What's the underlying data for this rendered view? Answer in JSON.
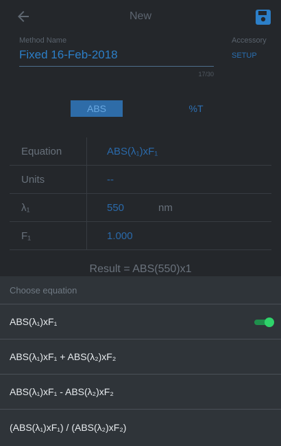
{
  "header": {
    "title": "New"
  },
  "method": {
    "label": "Method Name",
    "value": "Fixed 16-Feb-2018",
    "counter": "17/30"
  },
  "accessory": {
    "label": "Accessory",
    "setup": "SETUP"
  },
  "mode": {
    "abs": "ABS",
    "percent_t": "%T",
    "selected": "ABS"
  },
  "params": {
    "equation": {
      "label": "Equation",
      "value": "ABS(λ₁)xF₁"
    },
    "units": {
      "label": "Units",
      "value": "--"
    },
    "lambda1": {
      "label": "λ₁",
      "value": "550",
      "unit": "nm"
    },
    "f1": {
      "label": "F₁",
      "value": "1.000"
    }
  },
  "result": "Result = ABS(550)x1",
  "sheet": {
    "title": "Choose equation",
    "options": [
      {
        "label": "ABS(λ₁)xF₁",
        "selected": true
      },
      {
        "label": "ABS(λ₁)xF₁ + ABS(λ₂)xF₂",
        "selected": false
      },
      {
        "label": "ABS(λ₁)xF₁ - ABS(λ₂)xF₂",
        "selected": false
      },
      {
        "label": "(ABS(λ₁)xF₁) / (ABS(λ₂)xF₂)",
        "selected": false
      }
    ]
  },
  "icons": {
    "back": "back-arrow-icon",
    "save": "save-icon",
    "toggle": "toggle-on-icon"
  },
  "colors": {
    "background": "#24272b",
    "accent_blue": "#2c7fc8",
    "sheet_bg": "#2f3439",
    "toggle_green": "#2fd36a"
  }
}
